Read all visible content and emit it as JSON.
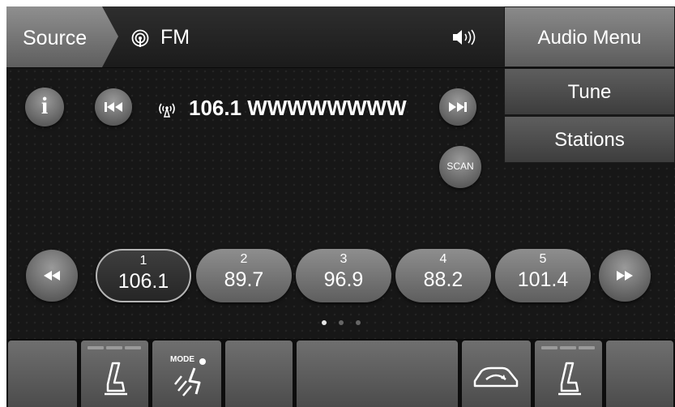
{
  "header": {
    "source_label": "Source",
    "band_label": "FM",
    "band_icon": "radio-signal-icon",
    "volume_icon": "speaker-volume-icon"
  },
  "menu": {
    "audio_menu": "Audio Menu",
    "tune": "Tune",
    "stations": "Stations"
  },
  "now_playing": {
    "station": "106.1 WWWWWWWW",
    "antenna_icon": "antenna-icon"
  },
  "controls": {
    "info_label": "i",
    "scan_label": "SCAN",
    "prev_icon": "skip-back-icon",
    "next_icon": "skip-forward-icon",
    "seek_back_icon": "rewind-icon",
    "seek_forward_icon": "fast-forward-icon"
  },
  "presets": [
    {
      "number": "1",
      "freq": "106.1",
      "selected": true
    },
    {
      "number": "2",
      "freq": "89.7",
      "selected": false
    },
    {
      "number": "3",
      "freq": "96.9",
      "selected": false
    },
    {
      "number": "4",
      "freq": "88.2",
      "selected": false
    },
    {
      "number": "5",
      "freq": "101.4",
      "selected": false
    }
  ],
  "pager": {
    "pages": 3,
    "current": 1
  },
  "climate": {
    "mode_label": "MODE",
    "icons": [
      "seat-heater-icon",
      "airflow-mode-icon",
      "recirculation-icon",
      "seat-heater-icon"
    ]
  },
  "colors": {
    "background": "#171717",
    "button_light": "#8e8e8e",
    "button_dark": "#5e5e5e",
    "text": "#ffffff"
  }
}
